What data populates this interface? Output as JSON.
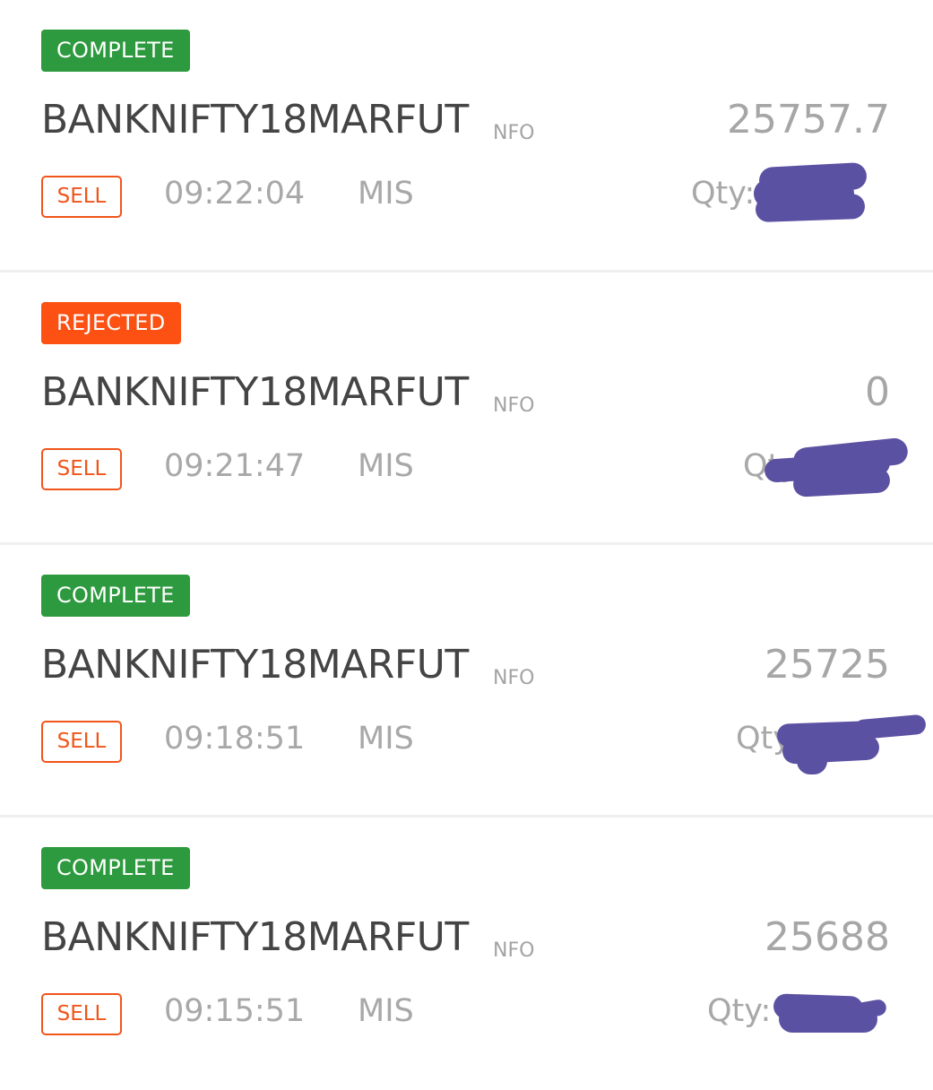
{
  "colors": {
    "complete": "#2e9a3f",
    "rejected": "#fc5113",
    "sell": "#f0551a",
    "redaction": "#5b51a2"
  },
  "orders": [
    {
      "status": "COMPLETE",
      "status_type": "complete",
      "symbol": "BANKNIFTY18MARFUT",
      "exchange": "NFO",
      "price": "25757.7",
      "side": "SELL",
      "time": "09:22:04",
      "product": "MIS",
      "qty_label": "Qty:",
      "qty_redacted": true
    },
    {
      "status": "REJECTED",
      "status_type": "rejected",
      "symbol": "BANKNIFTY18MARFUT",
      "exchange": "NFO",
      "price": "0",
      "side": "SELL",
      "time": "09:21:47",
      "product": "MIS",
      "qty_label": "Qty:",
      "qty_redacted": true
    },
    {
      "status": "COMPLETE",
      "status_type": "complete",
      "symbol": "BANKNIFTY18MARFUT",
      "exchange": "NFO",
      "price": "25725",
      "side": "SELL",
      "time": "09:18:51",
      "product": "MIS",
      "qty_label": "Qty:",
      "qty_redacted": true
    },
    {
      "status": "COMPLETE",
      "status_type": "complete",
      "symbol": "BANKNIFTY18MARFUT",
      "exchange": "NFO",
      "price": "25688",
      "side": "SELL",
      "time": "09:15:51",
      "product": "MIS",
      "qty_label": "Qty:",
      "qty_redacted": true
    }
  ]
}
